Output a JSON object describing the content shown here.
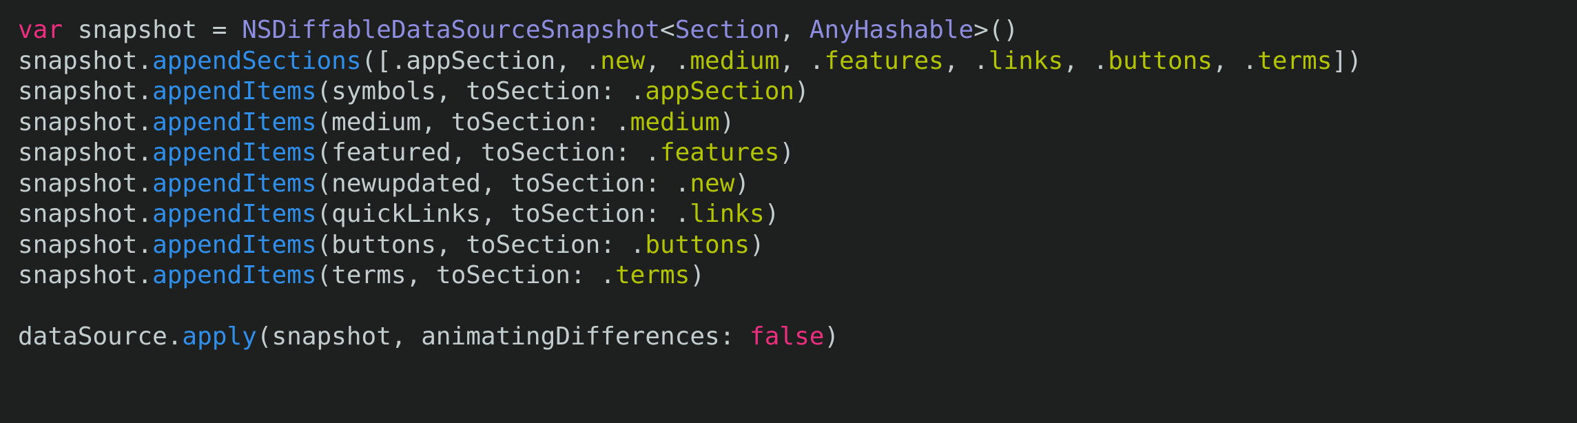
{
  "editor": {
    "background_color": "#1e2020",
    "language": "Swift",
    "font_size_px": 36,
    "colors": {
      "plain": "#c3cdcd",
      "keyword": "#ec2e7f",
      "type": "#8e8de0",
      "method": "#2f8fea",
      "enum_case": "#b3c400",
      "boolean": "#ec2e7f",
      "punctuation": "#c3cdcd"
    }
  },
  "code": {
    "full_text": "var snapshot = NSDiffableDataSourceSnapshot<Section, AnyHashable>()\nsnapshot.appendSections([.appSection, .new, .medium, .features, .links, .buttons, .terms])\nsnapshot.appendItems(symbols, toSection: .appSection)\nsnapshot.appendItems(medium, toSection: .medium)\nsnapshot.appendItems(featured, toSection: .features)\nsnapshot.appendItems(newupdated, toSection: .new)\nsnapshot.appendItems(quickLinks, toSection: .links)\nsnapshot.appendItems(buttons, toSection: .buttons)\nsnapshot.appendItems(terms, toSection: .terms)\n\ndataSource.apply(snapshot, animatingDifferences: false)",
    "lines": [
      {
        "index": 1,
        "tokens": [
          {
            "t": "var",
            "c": "keyword"
          },
          {
            "t": " snapshot = ",
            "c": "plain"
          },
          {
            "t": "NSDiffableDataSourceSnapshot",
            "c": "type"
          },
          {
            "t": "<",
            "c": "punct"
          },
          {
            "t": "Section",
            "c": "type"
          },
          {
            "t": ", ",
            "c": "punct"
          },
          {
            "t": "AnyHashable",
            "c": "type"
          },
          {
            "t": ">()",
            "c": "punct"
          }
        ]
      },
      {
        "index": 2,
        "tokens": [
          {
            "t": "snapshot.",
            "c": "plain"
          },
          {
            "t": "appendSections",
            "c": "method"
          },
          {
            "t": "([.appSection, .",
            "c": "plain"
          },
          {
            "t": "new",
            "c": "enum"
          },
          {
            "t": ", .",
            "c": "plain"
          },
          {
            "t": "medium",
            "c": "enum"
          },
          {
            "t": ", .",
            "c": "plain"
          },
          {
            "t": "features",
            "c": "enum"
          },
          {
            "t": ", .",
            "c": "plain"
          },
          {
            "t": "links",
            "c": "enum"
          },
          {
            "t": ", .",
            "c": "plain"
          },
          {
            "t": "buttons",
            "c": "enum"
          },
          {
            "t": ", .",
            "c": "plain"
          },
          {
            "t": "terms",
            "c": "enum"
          },
          {
            "t": "])",
            "c": "plain"
          }
        ]
      },
      {
        "index": 3,
        "tokens": [
          {
            "t": "snapshot.",
            "c": "plain"
          },
          {
            "t": "appendItems",
            "c": "method"
          },
          {
            "t": "(symbols, toSection: .",
            "c": "plain"
          },
          {
            "t": "appSection",
            "c": "enum"
          },
          {
            "t": ")",
            "c": "plain"
          }
        ]
      },
      {
        "index": 4,
        "tokens": [
          {
            "t": "snapshot.",
            "c": "plain"
          },
          {
            "t": "appendItems",
            "c": "method"
          },
          {
            "t": "(medium, toSection: .",
            "c": "plain"
          },
          {
            "t": "medium",
            "c": "enum"
          },
          {
            "t": ")",
            "c": "plain"
          }
        ]
      },
      {
        "index": 5,
        "tokens": [
          {
            "t": "snapshot.",
            "c": "plain"
          },
          {
            "t": "appendItems",
            "c": "method"
          },
          {
            "t": "(featured, toSection: .",
            "c": "plain"
          },
          {
            "t": "features",
            "c": "enum"
          },
          {
            "t": ")",
            "c": "plain"
          }
        ]
      },
      {
        "index": 6,
        "tokens": [
          {
            "t": "snapshot.",
            "c": "plain"
          },
          {
            "t": "appendItems",
            "c": "method"
          },
          {
            "t": "(newupdated, toSection: .",
            "c": "plain"
          },
          {
            "t": "new",
            "c": "enum"
          },
          {
            "t": ")",
            "c": "plain"
          }
        ]
      },
      {
        "index": 7,
        "tokens": [
          {
            "t": "snapshot.",
            "c": "plain"
          },
          {
            "t": "appendItems",
            "c": "method"
          },
          {
            "t": "(quickLinks, toSection: .",
            "c": "plain"
          },
          {
            "t": "links",
            "c": "enum"
          },
          {
            "t": ")",
            "c": "plain"
          }
        ]
      },
      {
        "index": 8,
        "tokens": [
          {
            "t": "snapshot.",
            "c": "plain"
          },
          {
            "t": "appendItems",
            "c": "method"
          },
          {
            "t": "(buttons, toSection: .",
            "c": "plain"
          },
          {
            "t": "buttons",
            "c": "enum"
          },
          {
            "t": ")",
            "c": "plain"
          }
        ]
      },
      {
        "index": 9,
        "tokens": [
          {
            "t": "snapshot.",
            "c": "plain"
          },
          {
            "t": "appendItems",
            "c": "method"
          },
          {
            "t": "(terms, toSection: .",
            "c": "plain"
          },
          {
            "t": "terms",
            "c": "enum"
          },
          {
            "t": ")",
            "c": "plain"
          }
        ]
      },
      {
        "index": 10,
        "tokens": []
      },
      {
        "index": 11,
        "tokens": [
          {
            "t": "dataSource.",
            "c": "plain"
          },
          {
            "t": "apply",
            "c": "method"
          },
          {
            "t": "(snapshot, animatingDifferences: ",
            "c": "plain"
          },
          {
            "t": "false",
            "c": "bool"
          },
          {
            "t": ")",
            "c": "plain"
          }
        ]
      }
    ]
  }
}
